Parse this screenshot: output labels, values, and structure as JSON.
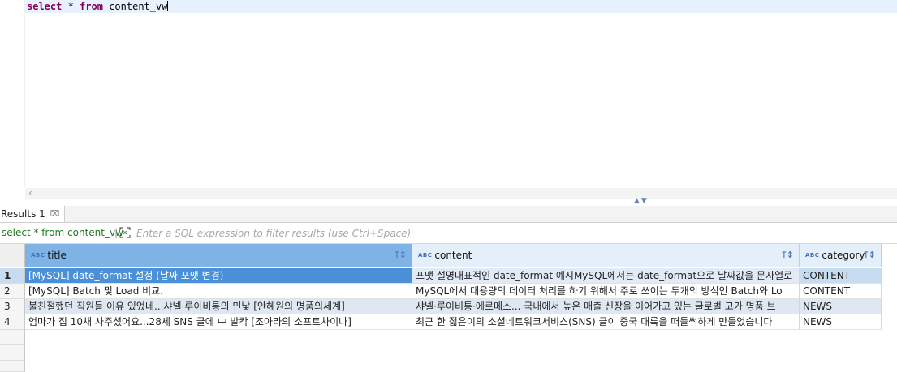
{
  "editor": {
    "kw_select": "select",
    "star": "*",
    "kw_from": "from",
    "table": "content_vw"
  },
  "results": {
    "tab_label": "Results 1",
    "query_text": "select * from content_vw",
    "filter_placeholder": "Enter a SQL expression to filter results (use Ctrl+Space)",
    "columns": [
      {
        "label": "title",
        "type_badge": "ABC"
      },
      {
        "label": "content",
        "type_badge": "ABC"
      },
      {
        "label": "category",
        "type_badge": "ABC"
      }
    ],
    "rows": [
      {
        "num": "1",
        "title": "[MySQL] date_format 설정 (날짜 포맷 변경)",
        "content": "포맷 설명대표적인 date_format 예시MySQL에서는 date_format으로 날짜값을 문자열로",
        "category": "CONTENT"
      },
      {
        "num": "2",
        "title": "[MySQL] Batch 및 Load 비교.",
        "content": "MySQL에서 대용량의 데이터 처리를 하기 위해서 주로 쓰이는 두개의 방식인 Batch와 Lo",
        "category": "CONTENT"
      },
      {
        "num": "3",
        "title": "불친절했던 직원들 이유 있었네...샤넬·루이비통의 민낯 [안혜원의 명품의세계]",
        "content": "샤넬·루이비통·에르메스... 국내에서 높은 매출 신장을 이어가고 있는 글로벌 고가 명품 브",
        "category": "NEWS"
      },
      {
        "num": "4",
        "title": "엄마가 집 10채 사주셨어요...28세 SNS 글에 中 발칵 [조아라의 소프트차이나]",
        "content": "최근 한 젊은이의 소셜네트워크서비스(SNS) 글이 중국 대륙을 떠들썩하게 만들었습니다",
        "category": "NEWS"
      }
    ]
  },
  "colors": {
    "keyword": "#7f0055",
    "query_green": "#217a21",
    "header_bg": "#e5effa",
    "selected_header": "#7fb3e6",
    "focus_cell": "#4a90d9"
  }
}
